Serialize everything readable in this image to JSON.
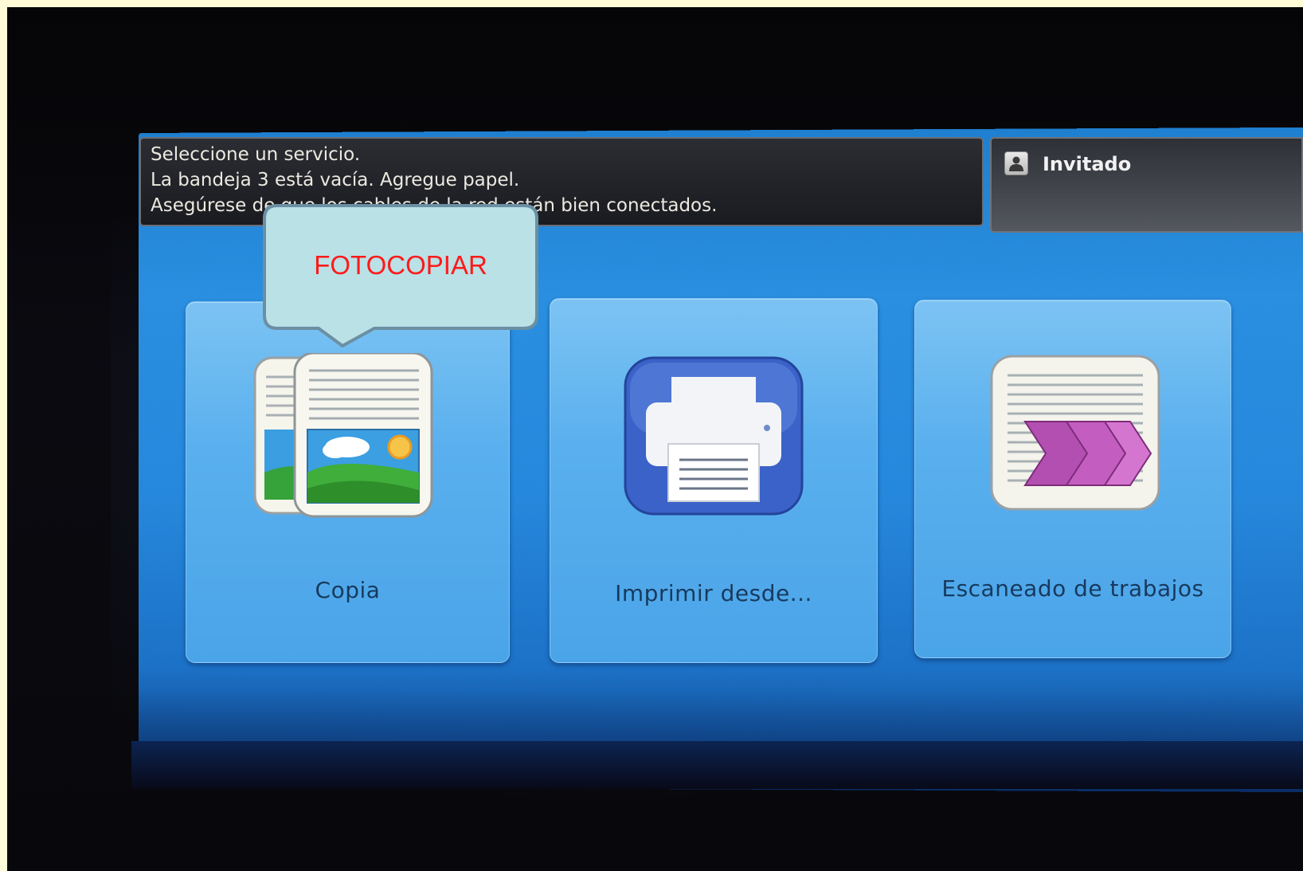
{
  "status_messages": [
    "Seleccione un servicio.",
    "La bandeja 3 está vacía. Agregue papel.",
    "Asegúrese de que los cables de la red están bien conectados."
  ],
  "user": {
    "name": "Invitado",
    "icon": "user-icon"
  },
  "services": [
    {
      "label": "Copia",
      "icon": "copy-icon"
    },
    {
      "label": "Imprimir desde...",
      "icon": "printer-icon"
    },
    {
      "label": "Escaneado de trabajos",
      "icon": "scan-workflow-icon"
    }
  ],
  "callout": {
    "text": "FOTOCOPIAR"
  },
  "colors": {
    "page_border": "#fefbd6",
    "screen_blue": "#2688dc",
    "tile_blue": "#5ab0ee",
    "callout_fill": "#b9e1e6",
    "callout_text": "#ff1a1a"
  }
}
